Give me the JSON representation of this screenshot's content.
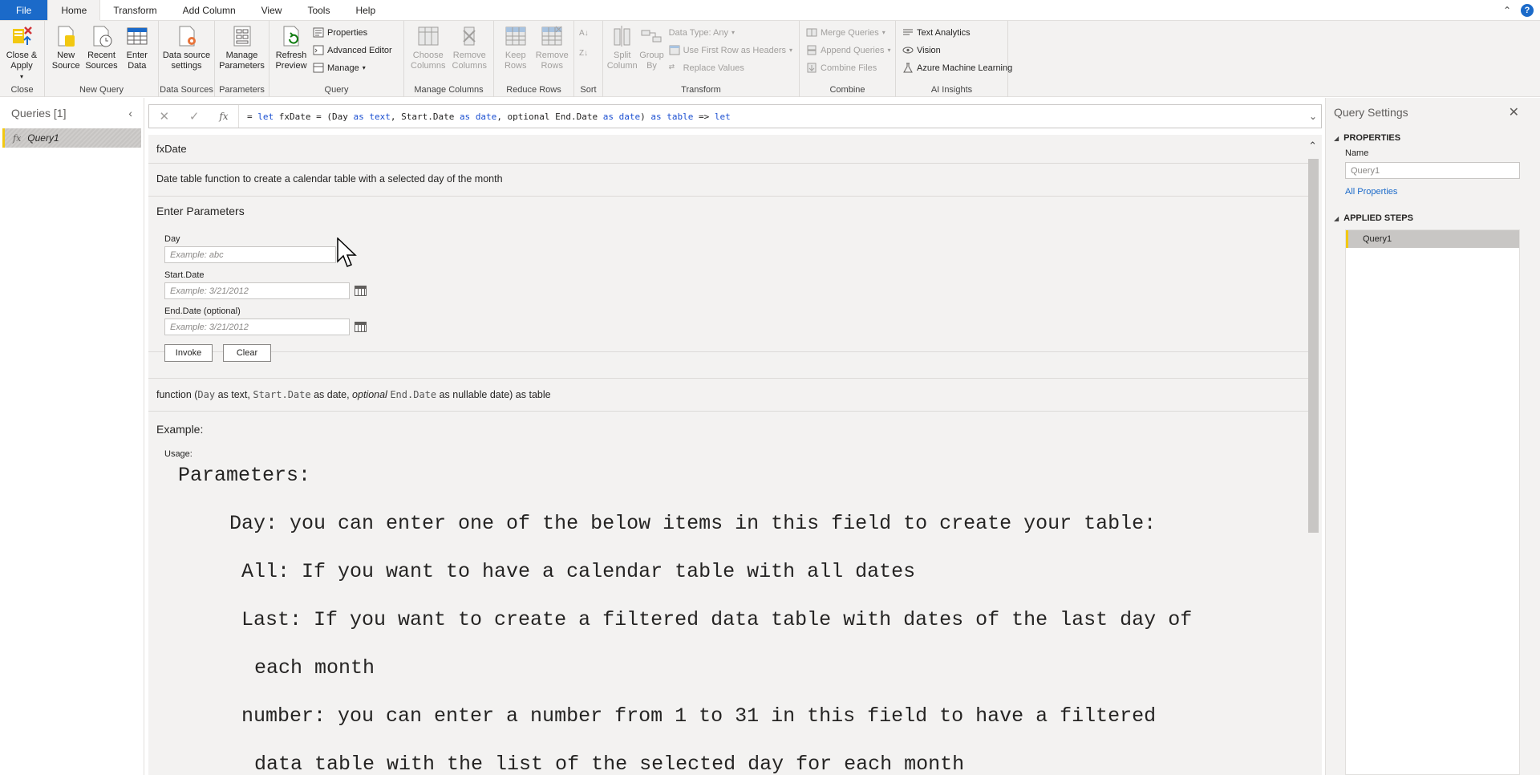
{
  "tabs": [
    {
      "label": "File"
    },
    {
      "label": "Home"
    },
    {
      "label": "Transform"
    },
    {
      "label": "Add Column"
    },
    {
      "label": "View"
    },
    {
      "label": "Tools"
    },
    {
      "label": "Help"
    }
  ],
  "ribbon": {
    "close": {
      "btn": "Close & Apply",
      "group": "Close"
    },
    "new_query": {
      "new_source": "New Source",
      "recent_sources": "Recent Sources",
      "enter_data": "Enter Data",
      "group": "New Query"
    },
    "data_sources": {
      "btn": "Data source settings",
      "group": "Data Sources"
    },
    "parameters": {
      "btn": "Manage Parameters",
      "group": "Parameters"
    },
    "query": {
      "refresh": "Refresh Preview",
      "properties": "Properties",
      "advanced_editor": "Advanced Editor",
      "manage": "Manage",
      "group": "Query"
    },
    "manage_columns": {
      "choose": "Choose Columns",
      "remove": "Remove Columns",
      "group": "Manage Columns"
    },
    "reduce_rows": {
      "keep": "Keep Rows",
      "remove": "Remove Rows",
      "group": "Reduce Rows"
    },
    "sort": {
      "group": "Sort"
    },
    "transform": {
      "split": "Split Column",
      "group_by": "Group By",
      "data_type": "Data Type: Any",
      "first_row": "Use First Row as Headers",
      "replace": "Replace Values",
      "group": "Transform"
    },
    "combine": {
      "merge": "Merge Queries",
      "append": "Append Queries",
      "combine_files": "Combine Files",
      "group": "Combine"
    },
    "ai": {
      "text_analytics": "Text Analytics",
      "vision": "Vision",
      "azure_ml": "Azure Machine Learning",
      "group": "AI Insights"
    }
  },
  "queries_pane": {
    "title": "Queries [1]",
    "items": [
      {
        "label": "Query1"
      }
    ]
  },
  "formula": {
    "parts": [
      "= ",
      "let",
      " fxDate = (Day ",
      "as",
      " ",
      "text",
      ", Start.Date ",
      "as",
      " ",
      "date",
      ", optional End.Date ",
      "as",
      " ",
      "date",
      ") ",
      "as",
      " ",
      "table",
      " => ",
      "let"
    ]
  },
  "main": {
    "func_name": "fxDate",
    "description": "Date table function to create a calendar table with a selected day of the month",
    "enter_params": "Enter Parameters",
    "params": [
      {
        "label": "Day",
        "placeholder": "Example: abc"
      },
      {
        "label": "Start.Date",
        "placeholder": "Example: 3/21/2012"
      },
      {
        "label": "End.Date (optional)",
        "placeholder": "Example: 3/21/2012"
      }
    ],
    "invoke": "Invoke",
    "clear": "Clear",
    "signature": {
      "p1": "function (",
      "c1": "Day",
      "p2": " as text, ",
      "c2": "Start.Date",
      "p3": " as date, ",
      "opt": "optional",
      "p4": " ",
      "c3": "End.Date",
      "p5": " as nullable date) as table"
    },
    "example_title": "Example:",
    "usage": "Usage:",
    "doc_lines": [
      "Parameters:",
      "Day: you can enter one of the below items in this field to create your table:",
      "All: If you want to have a calendar table with all dates",
      "Last: If you want to create a filtered data table with dates of the last day of",
      "each month",
      "number: you can enter a number from 1 to 31 in this field to have a filtered",
      "data table with the list of the selected day for each month"
    ]
  },
  "settings": {
    "title": "Query Settings",
    "properties": "PROPERTIES",
    "name_label": "Name",
    "name_value": "Query1",
    "all_properties": "All Properties",
    "applied_steps": "APPLIED STEPS",
    "steps": [
      "Query1"
    ]
  },
  "colors": {
    "accent": "#1b6ac9",
    "yellow": "#f2c811",
    "keyword": "#1b4fd1"
  }
}
